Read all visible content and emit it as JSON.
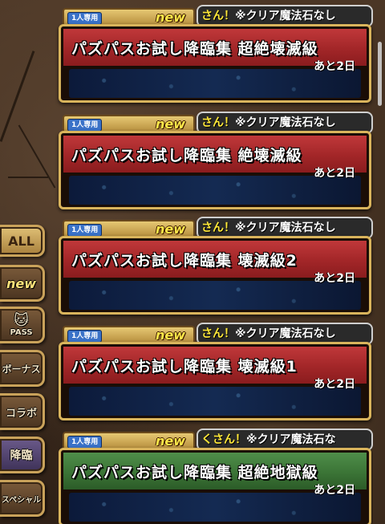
{
  "tabs": [
    {
      "id": "all",
      "label": "ALL",
      "selected": true
    },
    {
      "id": "new",
      "label": "new"
    },
    {
      "id": "pass",
      "label": "PASS"
    },
    {
      "id": "bonus",
      "label": "ボーナス"
    },
    {
      "id": "collab",
      "label": "コラボ"
    },
    {
      "id": "descend",
      "label": "降臨"
    },
    {
      "id": "special",
      "label": "スペシャル"
    }
  ],
  "cards": [
    {
      "badge": "1人専用",
      "new": "new",
      "ticker_a": "さん！",
      "ticker_b": "※クリア魔法石なし",
      "title": "パズパスお試し降臨集 超絶壊滅級",
      "remaining": "あと2日",
      "color": "red"
    },
    {
      "badge": "1人専用",
      "new": "new",
      "ticker_a": "さん！",
      "ticker_b": "※クリア魔法石なし",
      "title": "パズパスお試し降臨集 絶壊滅級",
      "remaining": "あと2日",
      "color": "red"
    },
    {
      "badge": "1人専用",
      "new": "new",
      "ticker_a": "さん！",
      "ticker_b": "※クリア魔法石なし",
      "title": "パズパスお試し降臨集 壊滅級2",
      "remaining": "あと2日",
      "color": "red"
    },
    {
      "badge": "1人専用",
      "new": "new",
      "ticker_a": "さん！",
      "ticker_b": "※クリア魔法石なし",
      "title": "パズパスお試し降臨集 壊滅級1",
      "remaining": "あと2日",
      "color": "red"
    },
    {
      "badge": "1人専用",
      "new": "new",
      "ticker_a": "くさん！",
      "ticker_b": "※クリア魔法石な",
      "title": "パズパスお試し降臨集 超絶地獄級",
      "remaining": "あと2日",
      "color": "green"
    }
  ]
}
